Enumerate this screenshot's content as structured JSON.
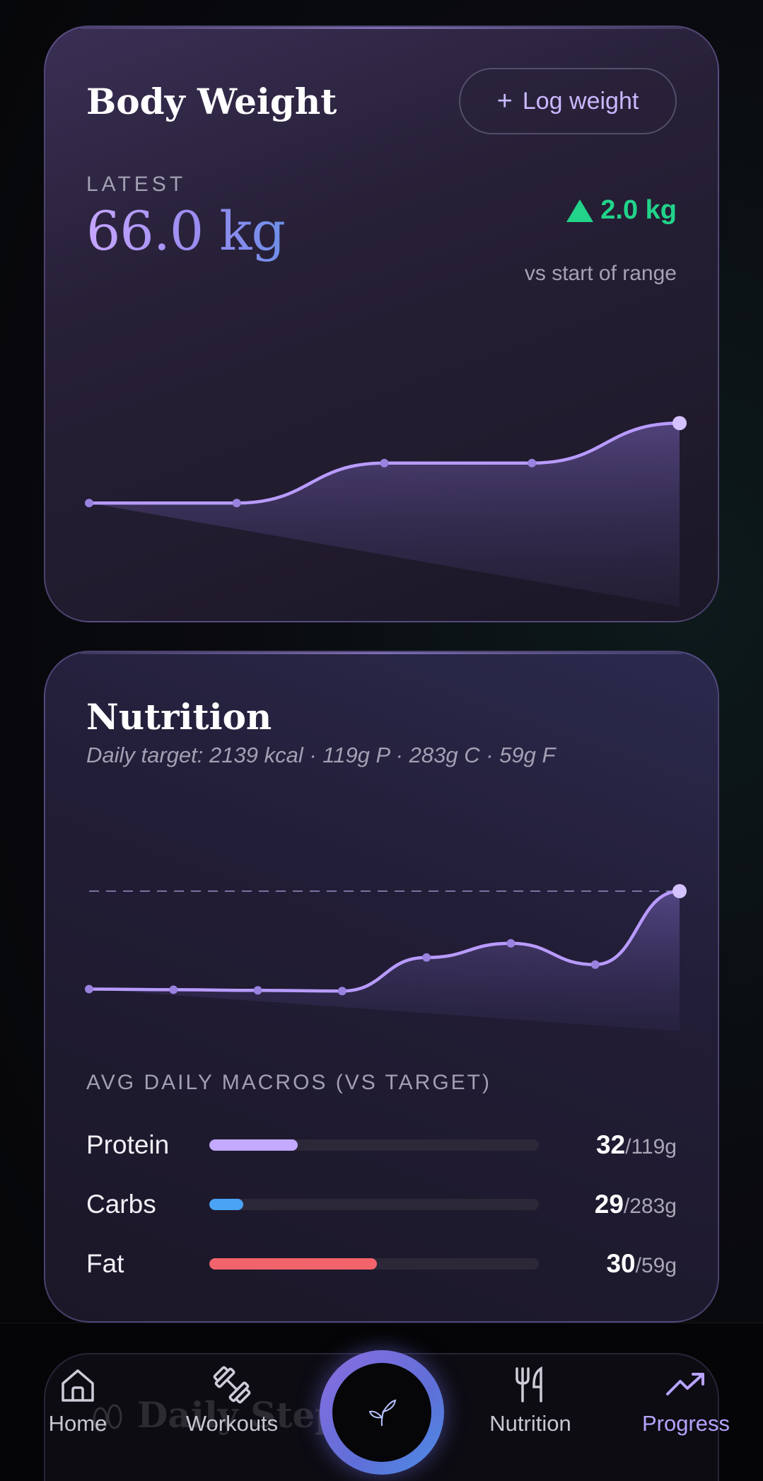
{
  "weight_card": {
    "title": "Body Weight",
    "log_button_label": "Log weight",
    "latest_label": "LATEST",
    "latest_value": "66.0 kg",
    "delta_value": "2.0 kg",
    "delta_caption": "vs start of range",
    "delta_color": "#22d38a"
  },
  "nutrition_card": {
    "title": "Nutrition",
    "subtitle": "Daily target: 2139 kcal · 119g P · 283g C · 59g F",
    "macros_label": "AVG DAILY MACROS (VS TARGET)",
    "macros": [
      {
        "name": "Protein",
        "value": "32",
        "target": "/119g",
        "fraction": 0.269,
        "color": "#c3a9ff"
      },
      {
        "name": "Carbs",
        "value": "29",
        "target": "/283g",
        "fraction": 0.102,
        "color": "#4aa3f5"
      },
      {
        "name": "Fat",
        "value": "30",
        "target": "/59g",
        "fraction": 0.508,
        "color": "#f2636b"
      }
    ]
  },
  "chart_data": [
    {
      "type": "area",
      "x": [
        1,
        2,
        3,
        4,
        5
      ],
      "series": [
        {
          "values": [
            64.0,
            64.0,
            65.0,
            65.0,
            66.0
          ]
        }
      ],
      "ylim": [
        62.5,
        66.5
      ],
      "grid": false,
      "title": "",
      "xlabel": "",
      "ylabel": "",
      "color": "#b89bff"
    },
    {
      "type": "area",
      "x": [
        1,
        2,
        3,
        4,
        5,
        6,
        7,
        8
      ],
      "series": [
        {
          "values": [
            620,
            610,
            600,
            590,
            1110,
            1330,
            1000,
            2139
          ]
        }
      ],
      "target": 2139,
      "ylim": [
        0,
        2139
      ],
      "grid": false,
      "title": "",
      "xlabel": "",
      "ylabel": "",
      "color": "#b89bff"
    }
  ],
  "nav": {
    "items": [
      {
        "label": "Home",
        "icon": "home-icon"
      },
      {
        "label": "Workouts",
        "icon": "dumbbell-icon"
      },
      {
        "label": "Nutrition",
        "icon": "fork-knife-icon"
      },
      {
        "label": "Progress",
        "icon": "trending-up-icon"
      }
    ],
    "center_icon": "sprout-icon",
    "active_color": "#b8a3ff",
    "peek_title": "Daily Steps"
  }
}
